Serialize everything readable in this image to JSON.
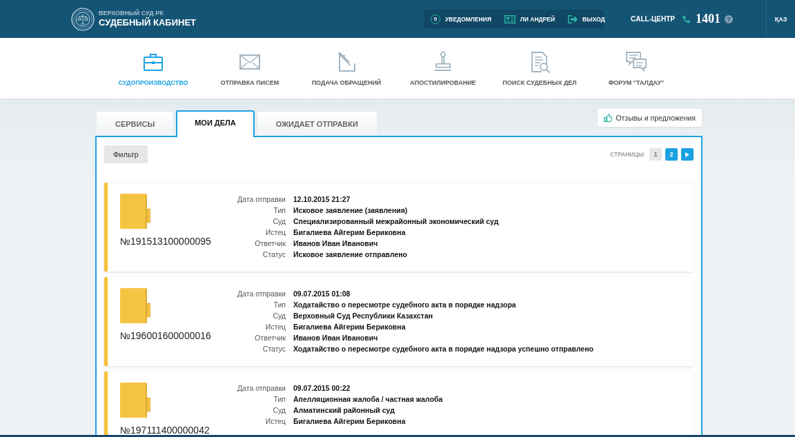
{
  "header": {
    "org": "ВЕРХОВНЫЙ СУД РК",
    "title": "СУДЕБНЫЙ КАБИНЕТ",
    "user_bar": [
      {
        "kind": "notifications",
        "count": "0",
        "label": "УВЕДОМЛЕНИЯ"
      },
      {
        "kind": "profile",
        "label": "ЛИ АНДРЕЙ"
      },
      {
        "kind": "logout",
        "label": "ВЫХОД"
      }
    ],
    "call_center": {
      "label": "CALL-ЦЕНТР",
      "number": "1401",
      "help": "?"
    },
    "language": "ҚАЗ"
  },
  "nav": [
    {
      "kind": "briefcase",
      "label": "СУДОПРОИЗВОДСТВО",
      "selected": true
    },
    {
      "kind": "envelope",
      "label": "ОТПРАВКА ПИСЕМ",
      "selected": false
    },
    {
      "kind": "edit",
      "label": "ПОДАЧА ОБРАЩЕНИЙ",
      "selected": false
    },
    {
      "kind": "stamp",
      "label": "АПОСТИЛИРОВАНИЕ",
      "selected": false
    },
    {
      "kind": "search",
      "label": "ПОИСК СУДЕБНЫХ ДЕЛ",
      "selected": false
    },
    {
      "kind": "chat",
      "label": "ФОРУМ \"ТАЛДАУ\"",
      "selected": false
    }
  ],
  "tabs": [
    {
      "label": "СЕРВИСЫ",
      "selected": false
    },
    {
      "label": "МОИ ДЕЛА",
      "selected": true
    },
    {
      "label": "ОЖИДАЕТ ОТПРАВКИ",
      "selected": false
    }
  ],
  "feedback_button": "Отзывы и предложения",
  "filter_button": "Фильтр",
  "pagination": {
    "label": "СТРАНИЦЫ",
    "pages": [
      {
        "label": "1",
        "selected": true
      },
      {
        "label": "2",
        "selected": false
      }
    ]
  },
  "cases": [
    {
      "number": "№191513100000095",
      "fields": [
        {
          "label": "Дата отправки",
          "value": "12.10.2015 21:27"
        },
        {
          "label": "Тип",
          "value": "Исковое заявление (заявления)"
        },
        {
          "label": "Суд",
          "value": "Специализированный межрайонный экономический суд"
        },
        {
          "label": "Истец",
          "value": "Бигалиева Айгерим Бериковна"
        },
        {
          "label": "Ответчик",
          "value": "Иванов Иван Иванович"
        },
        {
          "label": "Статус",
          "value": "Исковое заявление отправлено"
        }
      ]
    },
    {
      "number": "№196001600000016",
      "fields": [
        {
          "label": "Дата отправки",
          "value": "09.07.2015 01:08"
        },
        {
          "label": "Тип",
          "value": "Ходатайство о пересмотре судебного акта в порядке надзора"
        },
        {
          "label": "Суд",
          "value": "Верховный Суд Республики Казахстан"
        },
        {
          "label": "Истец",
          "value": "Бигалиева Айгерим Бериковна"
        },
        {
          "label": "Ответчик",
          "value": "Иванов Иван Иванович"
        },
        {
          "label": "Статус",
          "value": "Ходатайство о пересмотре судебного акта в порядке надзора успешно отправлено"
        }
      ]
    },
    {
      "number": "№197111400000042",
      "fields": [
        {
          "label": "Дата отправки",
          "value": "09.07.2015 00:22"
        },
        {
          "label": "Тип",
          "value": "Апелляционная жалоба / частная жалоба"
        },
        {
          "label": "Суд",
          "value": "Алматинский районный суд"
        },
        {
          "label": "Истец",
          "value": "Бигалиева Айгерим Бериковна"
        }
      ]
    }
  ]
}
